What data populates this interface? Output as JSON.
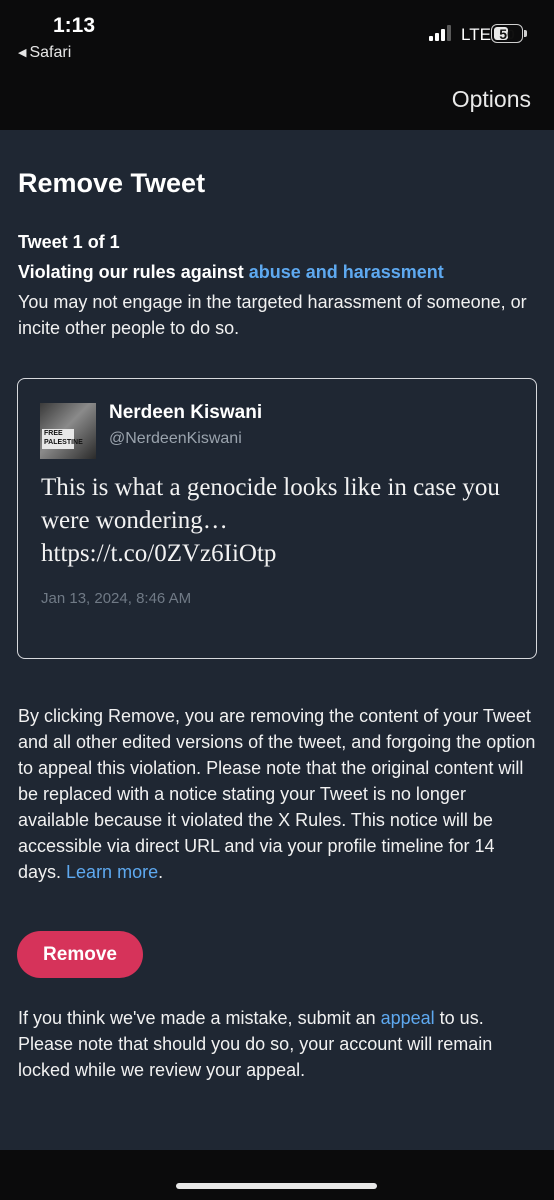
{
  "status_bar": {
    "time": "1:13",
    "back_app": "Safari",
    "network": "LTE",
    "battery": "50"
  },
  "header": {
    "options_label": "Options"
  },
  "page": {
    "title": "Remove Tweet",
    "tweet_count": "Tweet 1 of 1",
    "violation_prefix": "Violating our rules against ",
    "violation_link": "abuse and harassment",
    "violation_description": "You may not engage in the targeted harassment of someone, or incite other people to do so."
  },
  "tweet": {
    "author_name": "Nerdeen Kiswani",
    "author_handle": "@NerdeenKiswani",
    "text_line1": "This is what a genocide looks like in case you were wondering…",
    "text_line2": "https://t.co/0ZVz6IiOtp",
    "date": "Jan 13, 2024, 8:46 AM",
    "avatar_sign": "FREE PALESTINE"
  },
  "notice": {
    "text": "By clicking Remove, you are removing the content of your Tweet and all other edited versions of the tweet, and forgoing the option to appeal this violation. Please note that the original content will be replaced with a notice stating your Tweet is no longer available because it violated the X Rules. This notice will be accessible via direct URL and via your profile timeline for 14 days. ",
    "learn_more": "Learn more",
    "end": "."
  },
  "remove_button": "Remove",
  "appeal": {
    "prefix": "If you think we've made a mistake, submit an ",
    "link": "appeal",
    "suffix": " to us. Please note that should you do so, your account will remain locked while we review your appeal."
  },
  "colors": {
    "background": "#1f2733",
    "link": "#5ea9f0",
    "remove_button": "#d6335a"
  }
}
